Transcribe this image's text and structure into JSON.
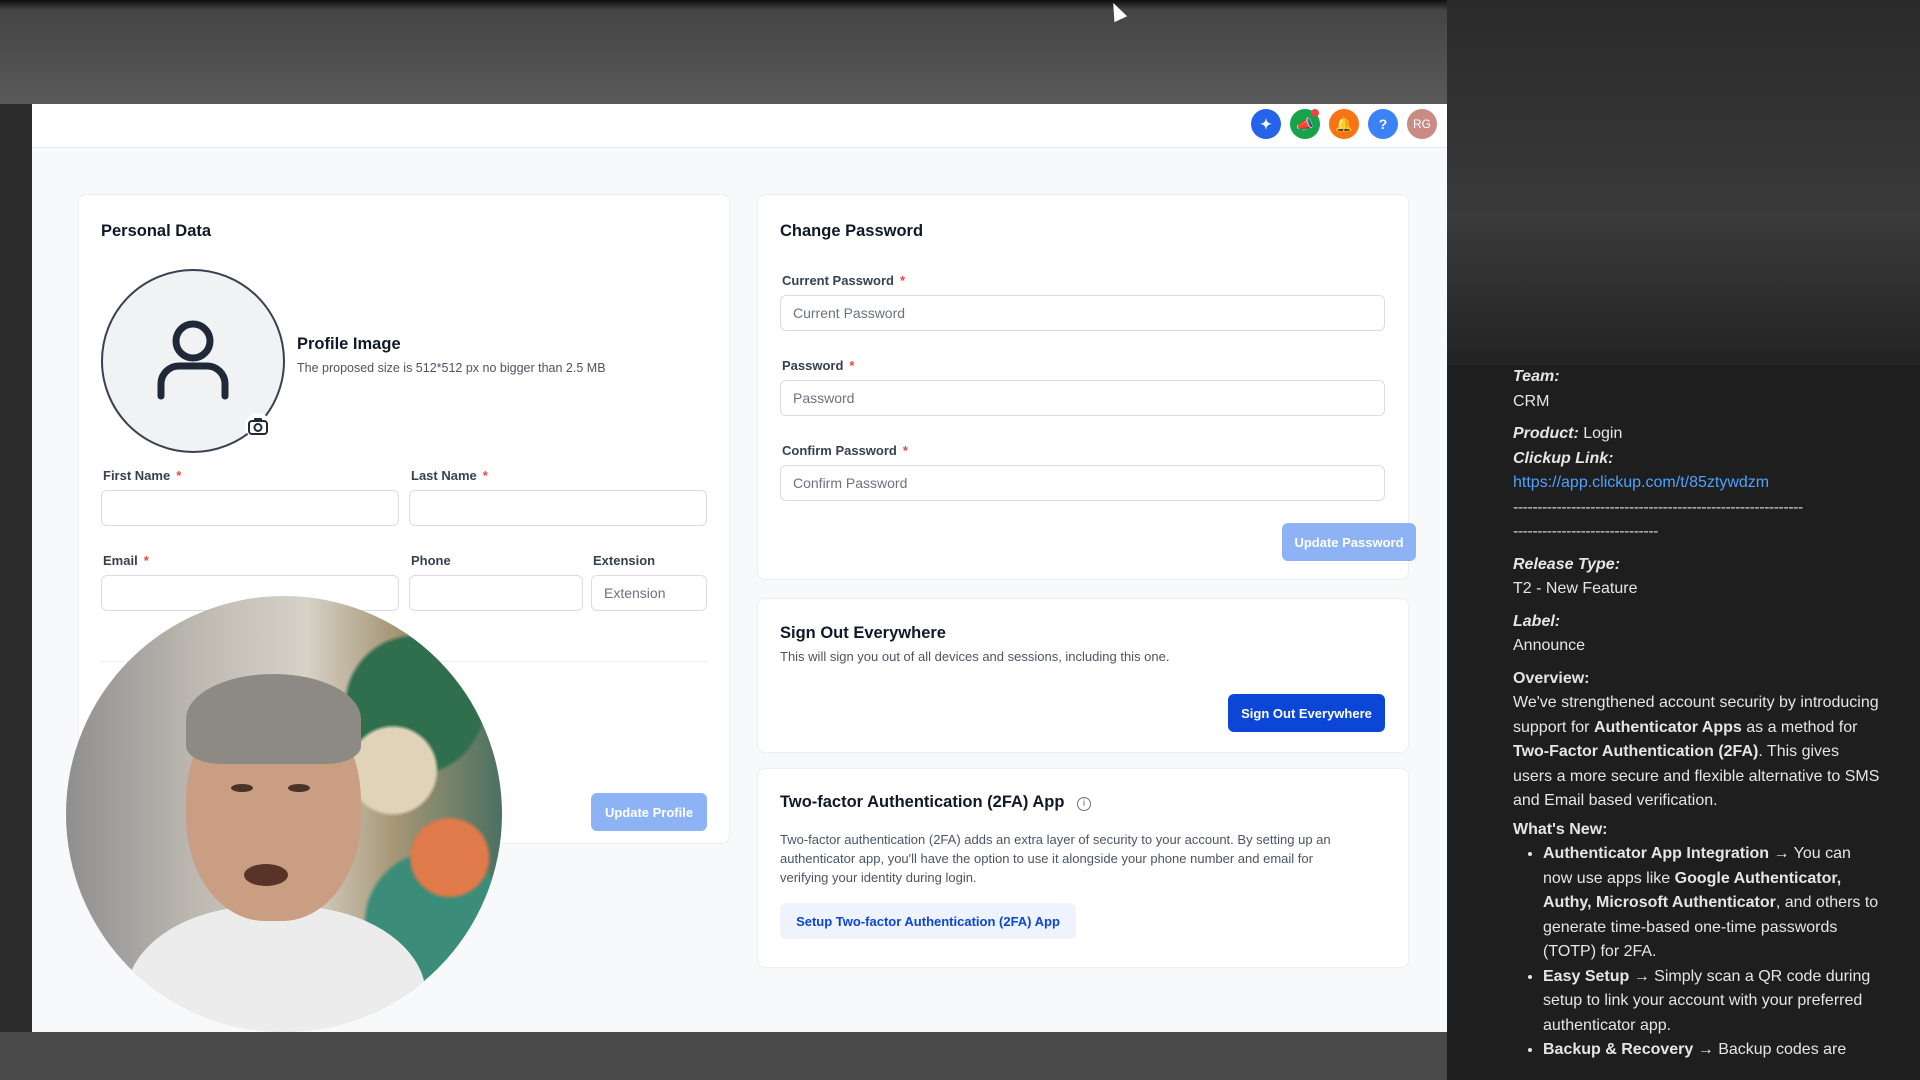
{
  "topbar": {
    "icons": [
      "sparkle-icon",
      "megaphone-icon",
      "bell-icon",
      "help-icon"
    ],
    "avatar_initials": "RG"
  },
  "personal": {
    "title": "Personal Data",
    "profile_image_title": "Profile Image",
    "profile_image_hint": "The proposed size is 512*512 px no bigger than 2.5 MB",
    "first_name_label": "First Name",
    "last_name_label": "Last Name",
    "email_label": "Email",
    "phone_label": "Phone",
    "extension_label": "Extension",
    "extension_placeholder": "Extension",
    "required_mark": "*",
    "update_button": "Update Profile"
  },
  "password": {
    "title": "Change Password",
    "current_label": "Current Password",
    "current_placeholder": "Current Password",
    "password_label": "Password",
    "password_placeholder": "Password",
    "confirm_label": "Confirm Password",
    "confirm_placeholder": "Confirm Password",
    "update_button": "Update Password"
  },
  "signout": {
    "title": "Sign Out Everywhere",
    "description": "This will sign you out of all devices and sessions, including this one.",
    "button": "Sign Out Everywhere"
  },
  "twofa": {
    "title": "Two-factor Authentication (2FA) App",
    "description_1": "Two-factor authentication (2FA) adds an extra layer of security to your account. By setting up an",
    "description_2": "authenticator app, you'll have the option to use it alongside your phone number and email for",
    "description_3": "verifying your identity during login.",
    "button": "Setup Two-factor Authentication (2FA) App"
  },
  "notes": {
    "team_label": "Team:",
    "team_value": "CRM",
    "product_label": "Product:",
    "product_value": "Login",
    "clickup_label": "Clickup Link:",
    "clickup_url": "https://app.clickup.com/t/85ztywdzm",
    "divider_1": "------------------------------------------------------------",
    "divider_2": "------------------------------",
    "release_label": "Release Type:",
    "release_value": "T2 - New Feature",
    "label_label": "Label:",
    "label_value": "Announce",
    "overview_label": "Overview:",
    "overview_1": "We've strengthened account security by introducing support for ",
    "overview_b1": "Authenticator Apps",
    "overview_2": " as a method for ",
    "overview_b2": "Two-Factor Authentication (2FA)",
    "overview_3": ". This gives users a more secure and flexible alternative to SMS and Email based verification.",
    "whats_new_label": "What's New:",
    "item1_b": "Authenticator App Integration",
    "item1_a": " → You can now use apps like ",
    "item1_b2": "Google Authenticator, Authy, Microsoft Authenticator",
    "item1_c": ", and others to generate time-based one-time passwords (TOTP) for 2FA.",
    "item2_b": "Easy Setup",
    "item2_a": " → Simply scan a QR code during setup to link your account with your preferred authenticator app.",
    "item3_b": "Backup & Recovery",
    "item3_a": " → Backup codes are"
  }
}
